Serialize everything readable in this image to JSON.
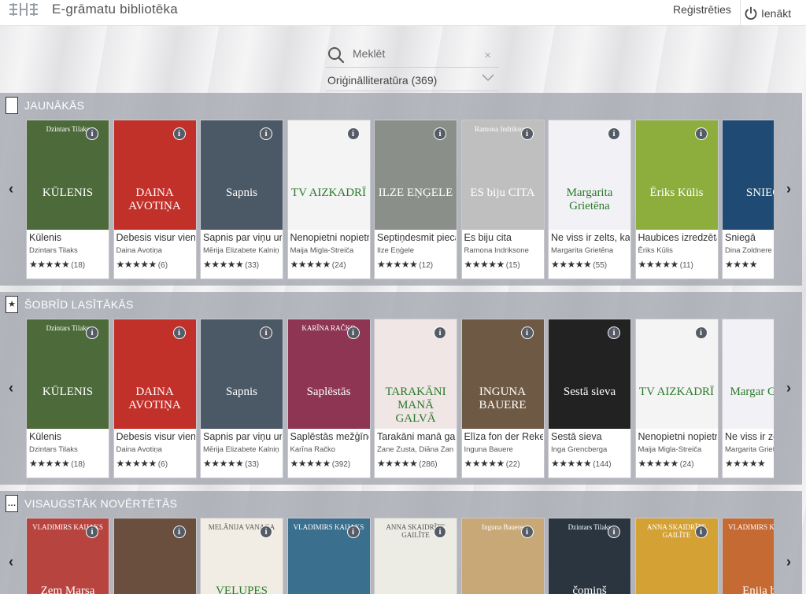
{
  "app": {
    "title": "E-grāmatu  bibliotēka",
    "register": "Reģistrēties",
    "login": "Ienākt"
  },
  "search": {
    "placeholder": "Meklēt",
    "filter": "Oriģinālliteratūra (369)"
  },
  "colors": {
    "shelf": "#a0a3ac",
    "info": "#555c66"
  },
  "shelves": [
    {
      "title": "JAUNĀKĀS",
      "icon": "book-icon",
      "books": [
        {
          "title": "Kūlenis",
          "author": "Dzintars Tilaks",
          "stars": "★★★★★",
          "count": "(18)",
          "cover_text": "KŪLENIS",
          "cover_top": "Dzintars Tilaks",
          "cover_bg": "#4d6b3a"
        },
        {
          "title": "Debesis visur vien",
          "author": "Daina Avotiņa",
          "stars": "★★★★★",
          "count": "(6)",
          "cover_text": "DAINA AVOTIŅA",
          "cover_top": "",
          "cover_bg": "#c2302a"
        },
        {
          "title": "Sapnis par viņu ur",
          "author": "Mērija Elizabete Kalniņ",
          "stars": "★★★★★",
          "count": "(33)",
          "cover_text": "Sapnis",
          "cover_top": "",
          "cover_bg": "#4b5866"
        },
        {
          "title": "Nenopietni nopietr",
          "author": "Maija Migla-Streiča",
          "stars": "★★★★★",
          "count": "(24)",
          "cover_text": "TV AIZKADRĪ",
          "cover_top": "",
          "cover_bg": "#f4f4f4"
        },
        {
          "title": "Septiņdesmit piecā",
          "author": "Ilze Eņģele",
          "stars": "★★★★★",
          "count": "(12)",
          "cover_text": "ILZE EŅĢELE",
          "cover_top": "",
          "cover_bg": "#8a8f8a"
        },
        {
          "title": "Es biju cita",
          "author": "Ramona Indriksone",
          "stars": "★★★★★",
          "count": "(15)",
          "cover_text": "ES biju CITA",
          "cover_top": "Ramona Indriksone",
          "cover_bg": "#bfbfbf"
        },
        {
          "title": "Ne viss ir zelts, ka",
          "author": "Margarita Grietēna",
          "stars": "★★★★★",
          "count": "(55)",
          "cover_text": "Margarita Grietēna",
          "cover_top": "",
          "cover_bg": "#f2f2f6"
        },
        {
          "title": "Haubices izredzēta",
          "author": "Ēriks Kūlis",
          "stars": "★★★★★",
          "count": "(11)",
          "cover_text": "Ēriks Kūlis",
          "cover_top": "",
          "cover_bg": "#8dae3c"
        },
        {
          "title": "Sniegā",
          "author": "Dina Zoldnere",
          "stars": "★★★★",
          "count": "",
          "cover_text": "SNIEG",
          "cover_top": "",
          "cover_bg": "#1e4a73"
        }
      ]
    },
    {
      "title": "ŠOBRĪD LASĪTĀKĀS",
      "icon": "star-icon",
      "books": [
        {
          "title": "Kūlenis",
          "author": "Dzintars Tilaks",
          "stars": "★★★★★",
          "count": "(18)",
          "cover_text": "KŪLENIS",
          "cover_top": "Dzintars Tilaks",
          "cover_bg": "#4d6b3a"
        },
        {
          "title": "Debesis visur vien",
          "author": "Daina Avotiņa",
          "stars": "★★★★★",
          "count": "(6)",
          "cover_text": "DAINA AVOTIŅA",
          "cover_top": "",
          "cover_bg": "#c2302a"
        },
        {
          "title": "Sapnis par viņu ur",
          "author": "Mērija Elizabete Kalniņ",
          "stars": "★★★★★",
          "count": "(33)",
          "cover_text": "Sapnis",
          "cover_top": "",
          "cover_bg": "#4b5866"
        },
        {
          "title": "Saplēstās mežģīne",
          "author": "Karīna Račko",
          "stars": "★★★★★",
          "count": "(392)",
          "cover_text": "Saplēstās",
          "cover_top": "KARĪNA RAČKO",
          "cover_bg": "#8e3553"
        },
        {
          "title": "Tarakāni manā gal",
          "author": "Zane Zusta, Diāna Zan",
          "stars": "★★★★★",
          "count": "(286)",
          "cover_text": "TARAKĀNI MANĀ GALVĀ",
          "cover_top": "",
          "cover_bg": "#f0e6e6"
        },
        {
          "title": "Elīza fon der Reke",
          "author": "Inguna Bauere",
          "stars": "★★★★★",
          "count": "(22)",
          "cover_text": "INGUNA BAUERE",
          "cover_top": "",
          "cover_bg": "#6e5a44"
        },
        {
          "title": "Sestā sieva",
          "author": "Inga Grencberga",
          "stars": "★★★★★",
          "count": "(144)",
          "cover_text": "Sestā sieva",
          "cover_top": "",
          "cover_bg": "#222222"
        },
        {
          "title": "Nenopietni nopietr",
          "author": "Maija Migla-Streiča",
          "stars": "★★★★★",
          "count": "(24)",
          "cover_text": "TV AIZKADRĪ",
          "cover_top": "",
          "cover_bg": "#f4f4f4"
        },
        {
          "title": "Ne viss ir ze",
          "author": "Margarita Griet",
          "stars": "★★★★★",
          "count": "",
          "cover_text": "Margar Grietē",
          "cover_top": "",
          "cover_bg": "#f2f2f6"
        }
      ]
    },
    {
      "title": "VISAUGSTĀK NOVĒRTĒTĀS",
      "icon": "ellipsis-icon",
      "books": [
        {
          "cover_text": "Zem Marsa",
          "cover_top": "VLADIMIRS KAIJAKS",
          "cover_bg": "#b8443f"
        },
        {
          "cover_text": "",
          "cover_top": "",
          "cover_bg": "#6a4f3e"
        },
        {
          "cover_text": "VELUPES KRASTĀ",
          "cover_top": "MELĀNIJA VANAGA",
          "cover_bg": "#f1ede4"
        },
        {
          "cover_text": "",
          "cover_top": "VLADIMIRS KAIJAKS",
          "cover_bg": "#3a6f8d"
        },
        {
          "cover_text": "",
          "cover_top": "ANNA SKAIDRĪTE GAILĪTE",
          "cover_bg": "#ecece4"
        },
        {
          "cover_text": "",
          "cover_top": "Inguna Bauere",
          "cover_bg": "#c9a877"
        },
        {
          "cover_text": "čomiņš",
          "cover_top": "Dzintars Tilaks",
          "cover_bg": "#2a3540"
        },
        {
          "cover_text": "",
          "cover_top": "ANNA SKAIDRĪTE GAILĪTE",
          "cover_bg": "#d4a135"
        },
        {
          "cover_text": "Enija biz",
          "cover_top": "VLADIMIRS KAIJAKS",
          "cover_bg": "#c56a33"
        }
      ]
    }
  ],
  "icons": {
    "search": "search-icon",
    "clear": "clear-icon",
    "chevron": "chevron-down-icon",
    "power": "power-icon",
    "info": "info-icon",
    "prev": "arrow-left-icon",
    "next": "arrow-right-icon"
  },
  "info_glyph": "i",
  "arrows": {
    "prev": "‹",
    "next": "›"
  },
  "clear_glyph": "×"
}
